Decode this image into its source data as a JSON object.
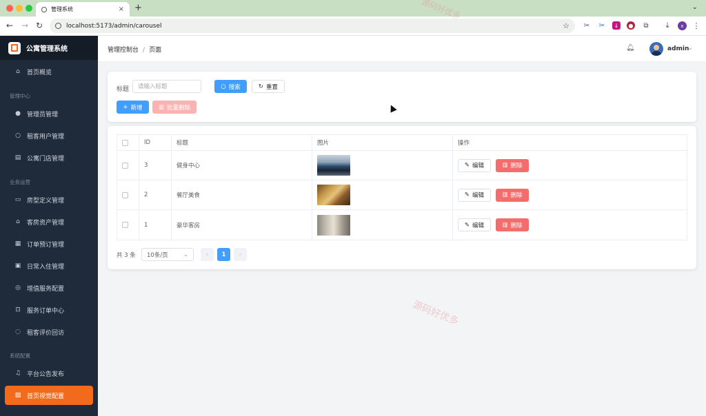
{
  "browser": {
    "tab_title": "管理系统",
    "url": "localhost:5173/admin/carousel",
    "profile_initial": "x"
  },
  "sidebar": {
    "brand": "公寓管理系统",
    "items": [
      {
        "label": "首页概览",
        "icon": "home-icon"
      },
      {
        "group": "管理中心"
      },
      {
        "label": "管理员管理",
        "icon": "user-icon"
      },
      {
        "label": "租客用户管理",
        "icon": "user-outline-icon"
      },
      {
        "label": "公寓门店管理",
        "icon": "building-icon"
      },
      {
        "group": "业务运营"
      },
      {
        "label": "房型定义管理",
        "icon": "document-icon"
      },
      {
        "label": "客房资产管理",
        "icon": "house-icon"
      },
      {
        "label": "订单预订管理",
        "icon": "calendar-icon"
      },
      {
        "label": "日常入住管理",
        "icon": "checkin-icon"
      },
      {
        "label": "增值服务配置",
        "icon": "headset-icon"
      },
      {
        "label": "服务订单中心",
        "icon": "cart-icon"
      },
      {
        "label": "租客评价回访",
        "icon": "chat-icon"
      },
      {
        "group": "系统配置"
      },
      {
        "label": "平台公告发布",
        "icon": "bell-icon"
      },
      {
        "label": "首页视觉配置",
        "icon": "picture-icon",
        "active": true
      }
    ]
  },
  "header": {
    "breadcrumb": [
      "管理控制台",
      "页面"
    ],
    "username": "admin"
  },
  "search": {
    "title_label": "标题",
    "title_placeholder": "请输入标题",
    "search_label": "搜索",
    "reset_label": "重置",
    "add_label": "新增",
    "batch_delete_label": "批量删除"
  },
  "table": {
    "columns": [
      "ID",
      "标题",
      "图片",
      "操作"
    ],
    "rows": [
      {
        "id": "3",
        "title": "健身中心",
        "image": "gym"
      },
      {
        "id": "2",
        "title": "餐厅美食",
        "image": "food"
      },
      {
        "id": "1",
        "title": "豪华客房",
        "image": "room"
      }
    ],
    "edit_label": "编辑",
    "delete_label": "删除"
  },
  "pagination": {
    "total_text": "共 3 条",
    "page_size": "10条/页",
    "current_page": "1",
    "prev": "‹",
    "next": "›"
  },
  "watermark": "源码好优多",
  "colors": {
    "primary": "#409eff",
    "danger": "#f56c6c",
    "accent": "#f26b1d",
    "sidebar_bg": "#1f2a3a"
  }
}
